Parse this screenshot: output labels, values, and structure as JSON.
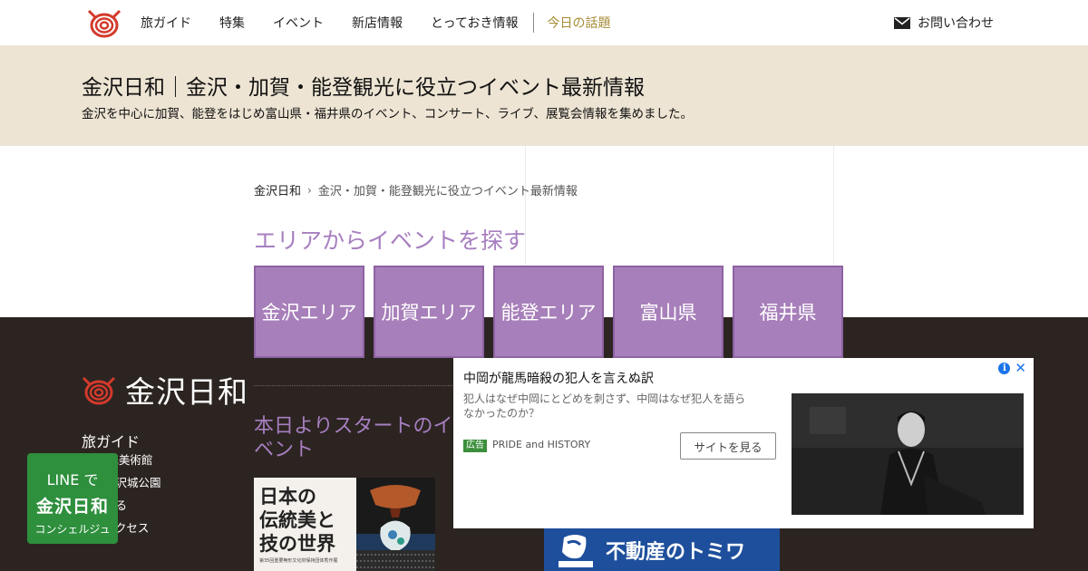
{
  "header": {
    "nav": [
      "旅ガイド",
      "特集",
      "イベント",
      "新店情報",
      "とっておき情報"
    ],
    "today": "今日の話題",
    "contact": "お問い合わせ"
  },
  "band": {
    "title": "金沢日和｜金沢・加賀・能登観光に役立つイベント最新情報",
    "subtitle": "金沢を中心に加賀、能登をはじめ富山県・福井県のイベント、コンサート、ライブ、展覧会情報を集めました。"
  },
  "breadcrumb": {
    "home": "金沢日和",
    "current": "金沢・加賀・能登観光に役立つイベント最新情報"
  },
  "area": {
    "heading": "エリアからイベントを探す",
    "buttons": [
      "金沢エリア",
      "加賀エリア",
      "能登エリア",
      "富山県",
      "福井県"
    ]
  },
  "footer": {
    "brand": "金沢日和",
    "travel_head": "旅ガイド",
    "links": [
      "21世紀美術館",
      "園／金沢城公園",
      "に泊まる",
      "へのアクセス"
    ]
  },
  "start": {
    "heading": "本日よりスタートのイベント",
    "thumb_text": [
      "日本の",
      "伝統美と",
      "技の世界"
    ],
    "thumb_small": "第35回重要無形文化財保持団体秀作展"
  },
  "line_badge": {
    "l1": "LINE で",
    "l2": "金沢日和",
    "l3": "コンシェルジュ"
  },
  "ad": {
    "title": "中岡が龍馬暗殺の犯人を言えぬ訳",
    "desc": "犯人はなぜ中岡にとどめを刺さず、中岡はなぜ犯人を語らなかったのか？",
    "label": "広告",
    "sponsor": "PRIDE and HISTORY",
    "cta": "サイトを見る",
    "close": "✕",
    "banner": "不動産のトミワ"
  },
  "colors": {
    "band": "#ede4d3",
    "dark": "#2c2421",
    "purple": "#a77fba",
    "gold": "#a68b34",
    "line_green": "#2e8f3d"
  }
}
